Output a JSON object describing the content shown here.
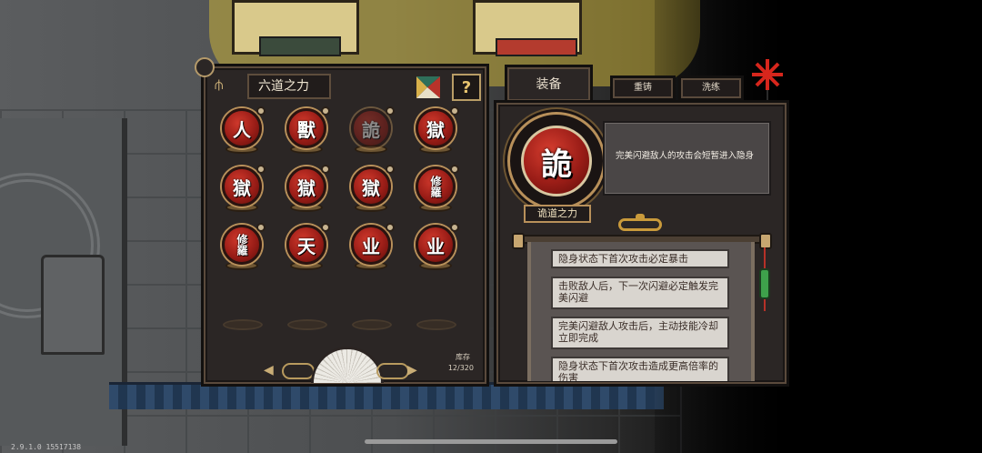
{
  "app": {
    "version": "2.9.1.0 15517138"
  },
  "left_panel": {
    "title": "六道之力",
    "help_label": "?",
    "icons": {
      "help": "question-icon",
      "filter": "triangle-palette-icon",
      "prev": "left-arrow-icon",
      "next": "right-arrow-icon",
      "fan": "fan-icon"
    },
    "orbs": [
      {
        "glyph": "人",
        "dim": false
      },
      {
        "glyph": "獸",
        "dim": false
      },
      {
        "glyph": "詭",
        "dim": true
      },
      {
        "glyph": "獄",
        "dim": false
      },
      {
        "glyph": "獄",
        "dim": false
      },
      {
        "glyph": "獄",
        "dim": false
      },
      {
        "glyph": "獄",
        "dim": false
      },
      {
        "glyph": "修羅",
        "dim": false
      },
      {
        "glyph": "修羅",
        "dim": false
      },
      {
        "glyph": "天",
        "dim": false
      },
      {
        "glyph": "业",
        "dim": false
      },
      {
        "glyph": "业",
        "dim": false
      }
    ],
    "empty_slots": 4,
    "stock_label": "库存",
    "stock_count": "12/320",
    "prev_arrow": "◀",
    "next_arrow": "▶"
  },
  "right_panel": {
    "tabs": {
      "equip": "装备",
      "recast": "重铸",
      "wash": "洗练"
    },
    "selected": {
      "glyph": "詭",
      "name": "诡道之力",
      "description": "完美闪避敌人的攻击会短暂进入隐身"
    },
    "perks": [
      "隐身状态下首次攻击必定暴击",
      "击败敌人后，下一次闪避必定触发完美闪避",
      "完美闪避敌人攻击后，主动技能冷却立即完成",
      "隐身状态下首次攻击造成更高倍率的伤害"
    ]
  },
  "colors": {
    "panel_bg": "#2b2625",
    "orb_red": "#9a1d17",
    "gold_trim": "#b8905a",
    "perk_bg": "#d9d5cf"
  }
}
